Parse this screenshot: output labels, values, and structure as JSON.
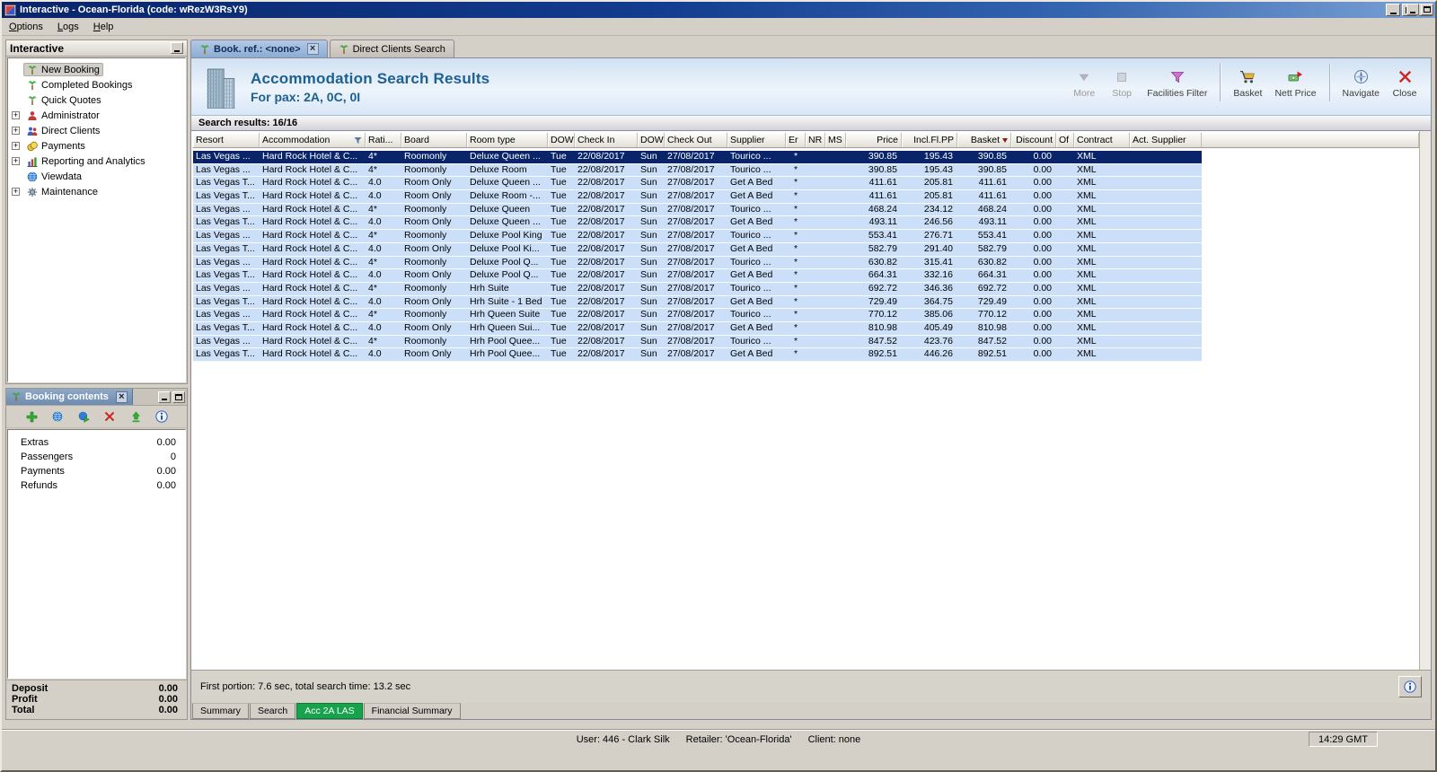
{
  "window": {
    "title": "Interactive - Ocean-Florida (code: wRezW3RsY9)"
  },
  "menu": {
    "items": [
      "Options",
      "Logs",
      "Help"
    ]
  },
  "sidebar": {
    "title": "Interactive",
    "items": [
      {
        "label": "New Booking",
        "icon": "palm-icon",
        "expander": "",
        "selected": true
      },
      {
        "label": "Completed Bookings",
        "icon": "palm-icon",
        "expander": "",
        "selected": false
      },
      {
        "label": "Quick Quotes",
        "icon": "palm-icon",
        "expander": "",
        "selected": false
      },
      {
        "label": "Administrator",
        "icon": "admin-icon",
        "expander": "+",
        "selected": false
      },
      {
        "label": "Direct Clients",
        "icon": "clients-icon",
        "expander": "+",
        "selected": false
      },
      {
        "label": "Payments",
        "icon": "payments-icon",
        "expander": "+",
        "selected": false
      },
      {
        "label": "Reporting and Analytics",
        "icon": "report-icon",
        "expander": "+",
        "selected": false
      },
      {
        "label": "Viewdata",
        "icon": "globe-icon",
        "expander": "",
        "selected": false
      },
      {
        "label": "Maintenance",
        "icon": "maintenance-icon",
        "expander": "+",
        "selected": false
      }
    ]
  },
  "booking_contents": {
    "title": "Booking contents",
    "toolbar": [
      "add-icon",
      "globe-icon",
      "globe-arrow-icon",
      "delete-icon",
      "import-icon",
      "info-icon"
    ],
    "rows": [
      {
        "label": "Extras",
        "value": "0.00"
      },
      {
        "label": "Passengers",
        "value": "0"
      },
      {
        "label": "Payments",
        "value": "0.00"
      },
      {
        "label": "Refunds",
        "value": "0.00"
      }
    ],
    "totals": [
      {
        "label": "Deposit",
        "value": "0.00"
      },
      {
        "label": "Profit",
        "value": "0.00"
      },
      {
        "label": "Total",
        "value": "0.00"
      }
    ]
  },
  "tabs": [
    {
      "label": "Book. ref.: <none>",
      "active": true,
      "closable": true
    },
    {
      "label": "Direct Clients Search",
      "active": false,
      "closable": false
    }
  ],
  "main": {
    "header": {
      "title": "Accommodation Search Results",
      "subtitle": "For pax: 2A, 0C, 0I"
    },
    "toolbar": [
      {
        "label": "More",
        "icon": "more-icon",
        "disabled": true,
        "group": false
      },
      {
        "label": "Stop",
        "icon": "stop-icon",
        "disabled": true,
        "group": false
      },
      {
        "label": "Facilities Filter",
        "icon": "filter-icon",
        "disabled": false,
        "group": false
      },
      {
        "label": "Basket",
        "icon": "basket-icon",
        "disabled": false,
        "group": true
      },
      {
        "label": "Nett Price",
        "icon": "nett-price-icon",
        "disabled": false,
        "group": false
      },
      {
        "label": "Navigate",
        "icon": "navigate-icon",
        "disabled": false,
        "group": true
      },
      {
        "label": "Close",
        "icon": "close-red-icon",
        "disabled": false,
        "group": false
      }
    ],
    "results_bar": "Search results: 16/16",
    "table": {
      "columns": [
        "Resort",
        "Accommodation",
        "Rati...",
        "Board",
        "Room type",
        "DOW",
        "Check In",
        "DOW",
        "Check Out",
        "Supplier",
        "Er",
        "NR",
        "MS",
        "Price",
        "Incl.Fl.PP",
        "Basket",
        "Discount",
        "Of",
        "Contract",
        "Act. Supplier"
      ],
      "rows": [
        [
          "Las Vegas ...",
          "Hard Rock Hotel & C...",
          "4*",
          "Roomonly",
          "Deluxe Queen ...",
          "Tue",
          "22/08/2017",
          "Sun",
          "27/08/2017",
          "Tourico ...",
          "*",
          "",
          "",
          "390.85",
          "195.43",
          "390.85",
          "0.00",
          "",
          "XML",
          ""
        ],
        [
          "Las Vegas ...",
          "Hard Rock Hotel & C...",
          "4*",
          "Roomonly",
          "Deluxe Room",
          "Tue",
          "22/08/2017",
          "Sun",
          "27/08/2017",
          "Tourico ...",
          "*",
          "",
          "",
          "390.85",
          "195.43",
          "390.85",
          "0.00",
          "",
          "XML",
          ""
        ],
        [
          "Las Vegas T...",
          "Hard Rock Hotel & C...",
          "4.0",
          "Room Only",
          "Deluxe Queen ...",
          "Tue",
          "22/08/2017",
          "Sun",
          "27/08/2017",
          "Get A Bed",
          "*",
          "",
          "",
          "411.61",
          "205.81",
          "411.61",
          "0.00",
          "",
          "XML",
          ""
        ],
        [
          "Las Vegas T...",
          "Hard Rock Hotel & C...",
          "4.0",
          "Room Only",
          "Deluxe Room -...",
          "Tue",
          "22/08/2017",
          "Sun",
          "27/08/2017",
          "Get A Bed",
          "*",
          "",
          "",
          "411.61",
          "205.81",
          "411.61",
          "0.00",
          "",
          "XML",
          ""
        ],
        [
          "Las Vegas ...",
          "Hard Rock Hotel & C...",
          "4*",
          "Roomonly",
          "Deluxe Queen",
          "Tue",
          "22/08/2017",
          "Sun",
          "27/08/2017",
          "Tourico ...",
          "*",
          "",
          "",
          "468.24",
          "234.12",
          "468.24",
          "0.00",
          "",
          "XML",
          ""
        ],
        [
          "Las Vegas T...",
          "Hard Rock Hotel & C...",
          "4.0",
          "Room Only",
          "Deluxe Queen ...",
          "Tue",
          "22/08/2017",
          "Sun",
          "27/08/2017",
          "Get A Bed",
          "*",
          "",
          "",
          "493.11",
          "246.56",
          "493.11",
          "0.00",
          "",
          "XML",
          ""
        ],
        [
          "Las Vegas ...",
          "Hard Rock Hotel & C...",
          "4*",
          "Roomonly",
          "Deluxe Pool King",
          "Tue",
          "22/08/2017",
          "Sun",
          "27/08/2017",
          "Tourico ...",
          "*",
          "",
          "",
          "553.41",
          "276.71",
          "553.41",
          "0.00",
          "",
          "XML",
          ""
        ],
        [
          "Las Vegas T...",
          "Hard Rock Hotel & C...",
          "4.0",
          "Room Only",
          "Deluxe Pool Ki...",
          "Tue",
          "22/08/2017",
          "Sun",
          "27/08/2017",
          "Get A Bed",
          "*",
          "",
          "",
          "582.79",
          "291.40",
          "582.79",
          "0.00",
          "",
          "XML",
          ""
        ],
        [
          "Las Vegas ...",
          "Hard Rock Hotel & C...",
          "4*",
          "Roomonly",
          "Deluxe Pool Q...",
          "Tue",
          "22/08/2017",
          "Sun",
          "27/08/2017",
          "Tourico ...",
          "*",
          "",
          "",
          "630.82",
          "315.41",
          "630.82",
          "0.00",
          "",
          "XML",
          ""
        ],
        [
          "Las Vegas T...",
          "Hard Rock Hotel & C...",
          "4.0",
          "Room Only",
          "Deluxe Pool Q...",
          "Tue",
          "22/08/2017",
          "Sun",
          "27/08/2017",
          "Get A Bed",
          "*",
          "",
          "",
          "664.31",
          "332.16",
          "664.31",
          "0.00",
          "",
          "XML",
          ""
        ],
        [
          "Las Vegas ...",
          "Hard Rock Hotel & C...",
          "4*",
          "Roomonly",
          "Hrh Suite",
          "Tue",
          "22/08/2017",
          "Sun",
          "27/08/2017",
          "Tourico ...",
          "*",
          "",
          "",
          "692.72",
          "346.36",
          "692.72",
          "0.00",
          "",
          "XML",
          ""
        ],
        [
          "Las Vegas T...",
          "Hard Rock Hotel & C...",
          "4.0",
          "Room Only",
          "Hrh Suite - 1 Bed",
          "Tue",
          "22/08/2017",
          "Sun",
          "27/08/2017",
          "Get A Bed",
          "*",
          "",
          "",
          "729.49",
          "364.75",
          "729.49",
          "0.00",
          "",
          "XML",
          ""
        ],
        [
          "Las Vegas ...",
          "Hard Rock Hotel & C...",
          "4*",
          "Roomonly",
          "Hrh Queen Suite",
          "Tue",
          "22/08/2017",
          "Sun",
          "27/08/2017",
          "Tourico ...",
          "*",
          "",
          "",
          "770.12",
          "385.06",
          "770.12",
          "0.00",
          "",
          "XML",
          ""
        ],
        [
          "Las Vegas T...",
          "Hard Rock Hotel & C...",
          "4.0",
          "Room Only",
          "Hrh Queen Sui...",
          "Tue",
          "22/08/2017",
          "Sun",
          "27/08/2017",
          "Get A Bed",
          "*",
          "",
          "",
          "810.98",
          "405.49",
          "810.98",
          "0.00",
          "",
          "XML",
          ""
        ],
        [
          "Las Vegas ...",
          "Hard Rock Hotel & C...",
          "4*",
          "Roomonly",
          "Hrh Pool Quee...",
          "Tue",
          "22/08/2017",
          "Sun",
          "27/08/2017",
          "Tourico ...",
          "*",
          "",
          "",
          "847.52",
          "423.76",
          "847.52",
          "0.00",
          "",
          "XML",
          ""
        ],
        [
          "Las Vegas T...",
          "Hard Rock Hotel & C...",
          "4.0",
          "Room Only",
          "Hrh Pool Quee...",
          "Tue",
          "22/08/2017",
          "Sun",
          "27/08/2017",
          "Get A Bed",
          "*",
          "",
          "",
          "892.51",
          "446.26",
          "892.51",
          "0.00",
          "",
          "XML",
          ""
        ]
      ]
    },
    "footer_status": "First portion: 7.6 sec, total search time: 13.2 sec",
    "bottom_tabs": [
      {
        "label": "Summary",
        "active": false
      },
      {
        "label": "Search",
        "active": false
      },
      {
        "label": "Acc 2A LAS",
        "active": true
      },
      {
        "label": "Financial Summary",
        "active": false
      }
    ]
  },
  "statusbar": {
    "user": "User: 446 - Clark Silk",
    "retailer": "Retailer: 'Ocean-Florida'",
    "client": "Client: none",
    "time": "14:29 GMT"
  },
  "colors": {
    "selected_row": "#0a246a",
    "row_highlight": "#cbdff8",
    "active_tab_green": "#17a24c",
    "header_text_blue": "#1d6091"
  }
}
